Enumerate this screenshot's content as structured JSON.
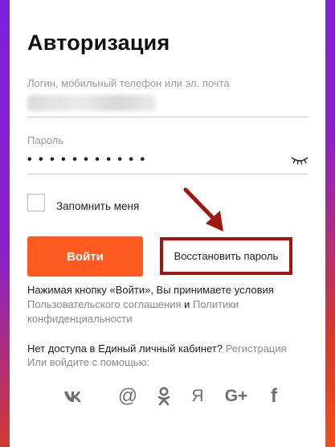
{
  "auth": {
    "title": "Авторизация",
    "login_label": "Логин, мобильный телефон или эл. почта",
    "login_value": "",
    "password_label": "Пароль",
    "password_value": "• • • • • • • • • • •",
    "remember_label": "Запомнить меня",
    "remember_checked": false,
    "login_button": "Войти",
    "restore_button": "Восстановить пароль"
  },
  "terms": {
    "prefix": "Нажимая кнопку «Войти», Вы принимаете условия",
    "agreement_link": "Пользовательского соглашения",
    "and": " и ",
    "policy_link": "Политики конфиденциальности"
  },
  "access": {
    "no_access": "Нет доступа в Единый личный кабинет? ",
    "register_link": "Регистрация",
    "or_login_with": "Или войдите с помощью:"
  },
  "socials": [
    {
      "name": "vk",
      "glyph": "vk"
    },
    {
      "name": "mail",
      "glyph": "@"
    },
    {
      "name": "odnoklassniki",
      "glyph": "ok"
    },
    {
      "name": "yandex",
      "glyph": "Я"
    },
    {
      "name": "google-plus",
      "glyph": "G+"
    },
    {
      "name": "facebook",
      "glyph": "f"
    }
  ],
  "colors": {
    "accent": "#ff5a1f",
    "highlight_border": "#a1160d",
    "link": "#8a8a8a",
    "icon": "#6f6f6f"
  }
}
